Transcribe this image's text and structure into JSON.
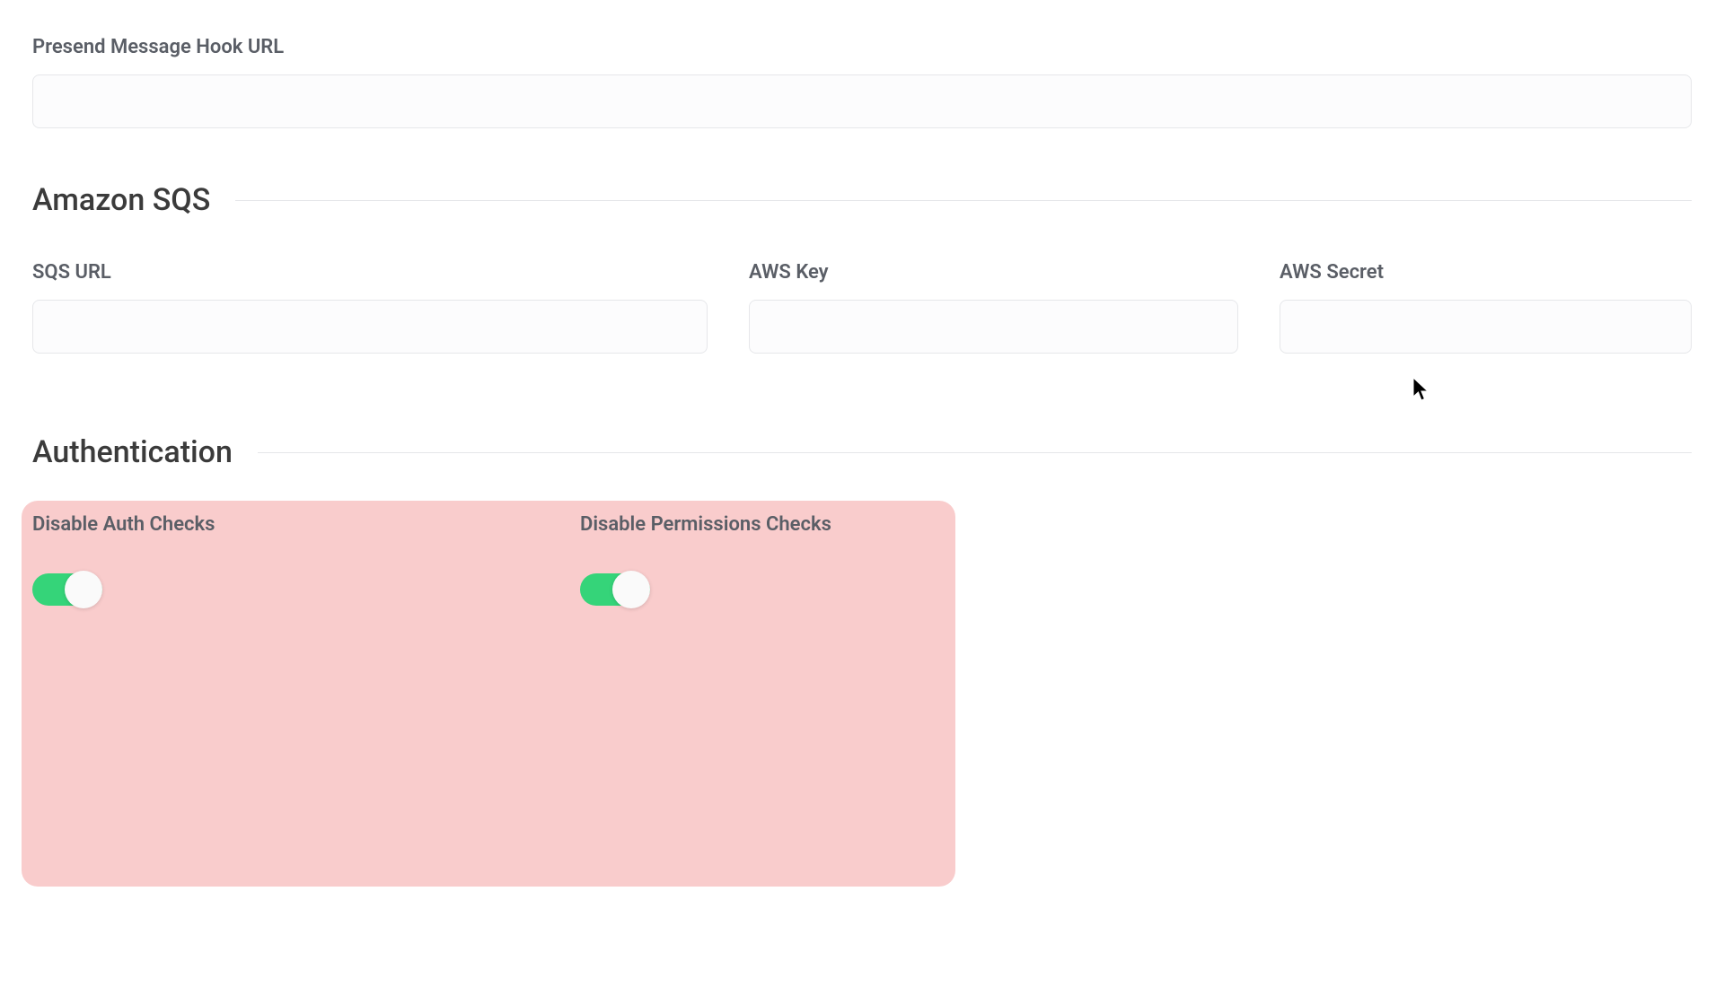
{
  "presend": {
    "label": "Presend Message Hook URL",
    "value": ""
  },
  "sqs": {
    "title": "Amazon SQS",
    "url_label": "SQS URL",
    "url_value": "",
    "key_label": "AWS Key",
    "key_value": "",
    "secret_label": "AWS Secret",
    "secret_value": ""
  },
  "auth": {
    "title": "Authentication",
    "disable_auth_label": "Disable Auth Checks",
    "disable_auth_on": true,
    "disable_perms_label": "Disable Permissions Checks",
    "disable_perms_on": true
  }
}
